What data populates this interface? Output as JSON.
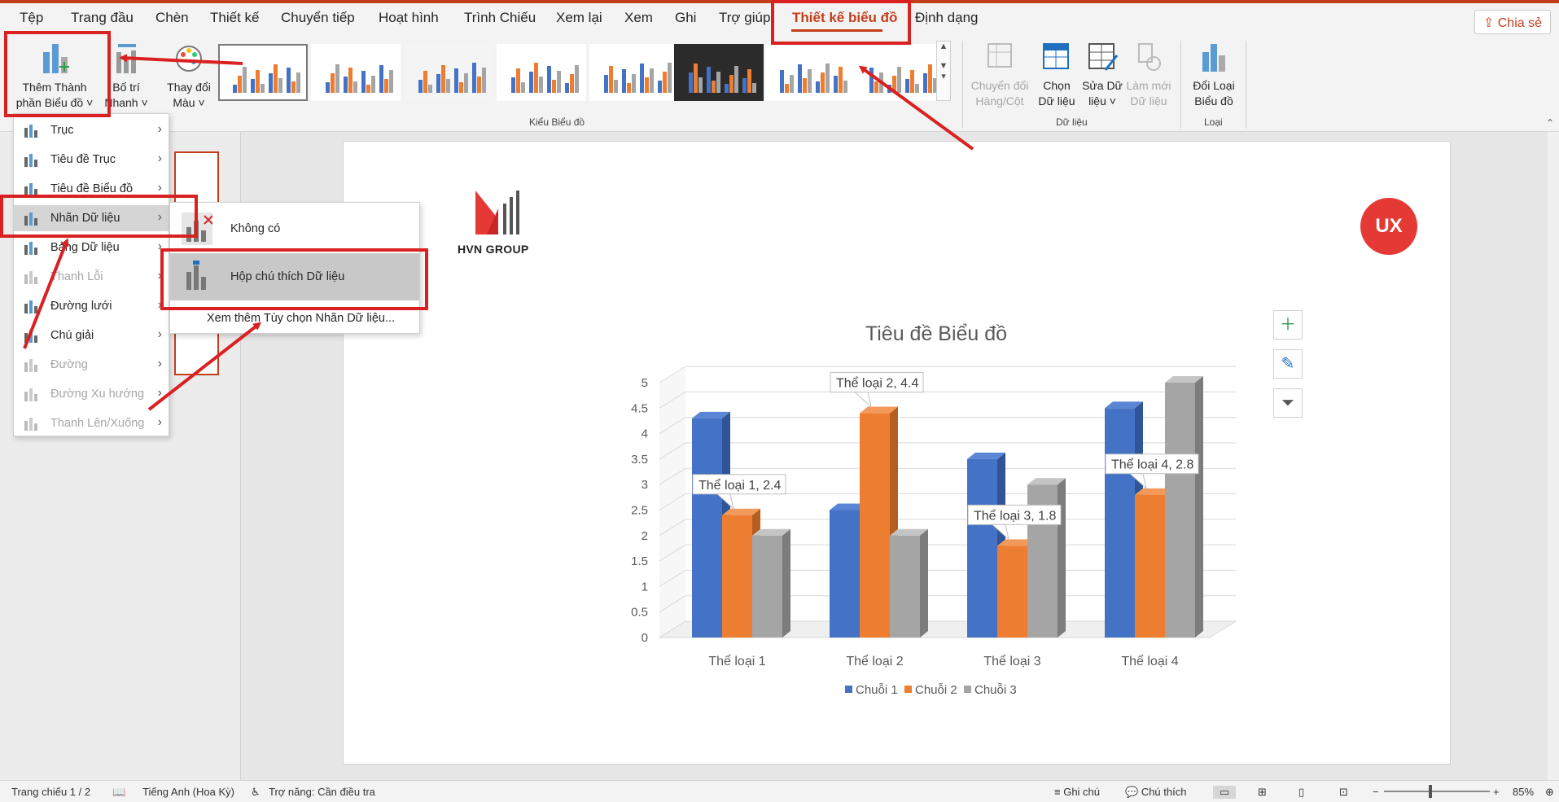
{
  "tabs": [
    "Tệp",
    "Trang đầu",
    "Chèn",
    "Thiết kế",
    "Chuyển tiếp",
    "Hoạt hình",
    "Trình Chiếu",
    "Xem lại",
    "Xem",
    "Ghi",
    "Trợ giúp",
    "Thiết kế biểu đồ",
    "Định dạng"
  ],
  "share_label": "Chia sẻ",
  "ribbon": {
    "add_element": [
      "Thêm Thành",
      "phần Biểu đồ"
    ],
    "quick_layout": [
      "Bố trí",
      "Nhanh"
    ],
    "change_colors": [
      "Thay đổi",
      "Màu"
    ],
    "styles_group": "Kiểu Biểu đồ",
    "switch_row_col": [
      "Chuyển đổi",
      "Hàng/Cột"
    ],
    "select_data": [
      "Chọn",
      "Dữ liệu"
    ],
    "edit_data": [
      "Sửa Dữ",
      "liệu"
    ],
    "refresh_data": [
      "Làm mới",
      "Dữ liệu"
    ],
    "data_group": "Dữ liệu",
    "change_type": [
      "Đổi Loại",
      "Biểu đồ"
    ],
    "type_group": "Loại"
  },
  "menu": {
    "items": [
      {
        "label": "Trục",
        "enabled": true
      },
      {
        "label": "Tiêu đề Trục",
        "enabled": true
      },
      {
        "label": "Tiêu đề Biểu đồ",
        "enabled": true
      },
      {
        "label": "Nhãn Dữ liệu",
        "enabled": true
      },
      {
        "label": "Bảng Dữ liệu",
        "enabled": true
      },
      {
        "label": "Thanh Lỗi",
        "enabled": false
      },
      {
        "label": "Đường lưới",
        "enabled": true
      },
      {
        "label": "Chú giải",
        "enabled": true
      },
      {
        "label": "Đường",
        "enabled": false
      },
      {
        "label": "Đường Xu hướng",
        "enabled": false
      },
      {
        "label": "Thanh Lên/Xuống",
        "enabled": false
      }
    ]
  },
  "submenu": {
    "none": "Không có",
    "callout": "Hộp chú thích Dữ liệu",
    "more": "Xem thêm Tùy chọn Nhãn Dữ liệu..."
  },
  "slide": {
    "logo_text": "HVN GROUP",
    "badge_text": "UX"
  },
  "chart_data": {
    "type": "bar",
    "title": "Tiêu đề Biểu đồ",
    "categories": [
      "Thể loại 1",
      "Thể loại 2",
      "Thể loại 3",
      "Thể loại 4"
    ],
    "series": [
      {
        "name": "Chuỗi 1",
        "values": [
          4.3,
          2.5,
          3.5,
          4.5
        ],
        "color": "#4472c4"
      },
      {
        "name": "Chuỗi 2",
        "values": [
          2.4,
          4.4,
          1.8,
          2.8
        ],
        "color": "#ed7d31"
      },
      {
        "name": "Chuỗi 3",
        "values": [
          2,
          2,
          3,
          5
        ],
        "color": "#a5a5a5"
      }
    ],
    "ylim": [
      0,
      5
    ],
    "yticks": [
      "0",
      "0.5",
      "1",
      "1.5",
      "2",
      "2.5",
      "3",
      "3.5",
      "4",
      "4.5",
      "5"
    ],
    "data_labels": [
      "Thể loại 1, 2.4",
      "Thể loại 2, 4.4",
      "Thể loại 3, 1.8",
      "Thể loại 4, 2.8"
    ],
    "legend_position": "bottom",
    "grid": true
  },
  "status": {
    "slide": "Trang chiếu 1 / 2",
    "language": "Tiếng Anh (Hoa Kỳ)",
    "accessibility": "Trợ năng: Cần điều tra",
    "notes": "Ghi chú",
    "comments": "Chú thích",
    "zoom": "85%"
  }
}
